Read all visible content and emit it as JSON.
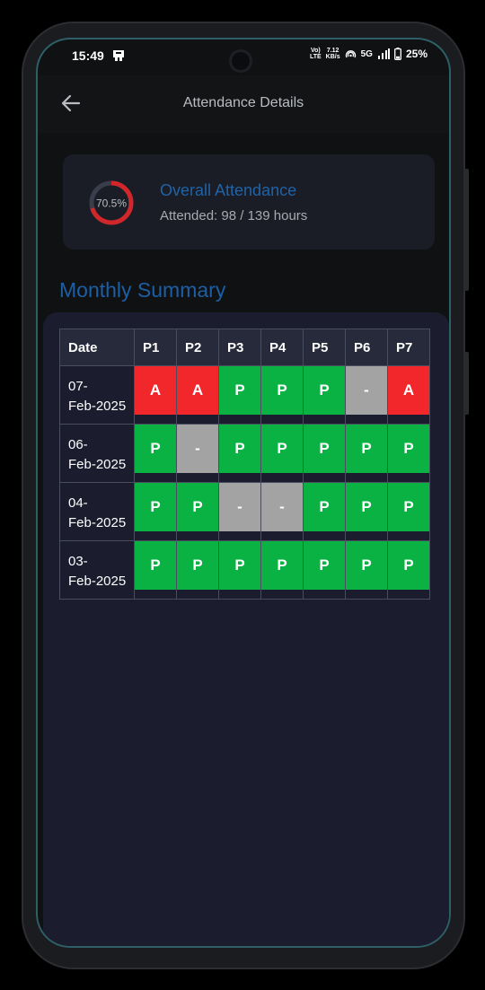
{
  "status_bar": {
    "time": "15:49",
    "network_type_top": "Vo)",
    "network_type_bottom": "LTE",
    "speed_value": "7.12",
    "speed_unit": "KB/s",
    "signal": "5G",
    "battery": "25%"
  },
  "header": {
    "title": "Attendance Details"
  },
  "overall": {
    "percent_label": "70.5%",
    "percent_value": 70.5,
    "title": "Overall Attendance",
    "subtitle": "Attended: 98 / 139 hours"
  },
  "section_title": "Monthly Summary",
  "table": {
    "headers": [
      "Date",
      "P1",
      "P2",
      "P3",
      "P4",
      "P5",
      "P6",
      "P7"
    ],
    "rows": [
      {
        "date_line1": "07-",
        "date_line2": "Feb-2025",
        "cells": [
          "A",
          "A",
          "P",
          "P",
          "P",
          "-",
          "A"
        ]
      },
      {
        "date_line1": "06-",
        "date_line2": "Feb-2025",
        "cells": [
          "P",
          "-",
          "P",
          "P",
          "P",
          "P",
          "P"
        ]
      },
      {
        "date_line1": "04-",
        "date_line2": "Feb-2025",
        "cells": [
          "P",
          "P",
          "-",
          "-",
          "P",
          "P",
          "P"
        ]
      },
      {
        "date_line1": "03-",
        "date_line2": "Feb-2025",
        "cells": [
          "P",
          "P",
          "P",
          "P",
          "P",
          "P",
          "P"
        ]
      }
    ]
  },
  "colors": {
    "absent": "#f2272b",
    "present": "#0ab243",
    "no_class": "#a3a3a3",
    "accent": "#1c5fa4"
  }
}
